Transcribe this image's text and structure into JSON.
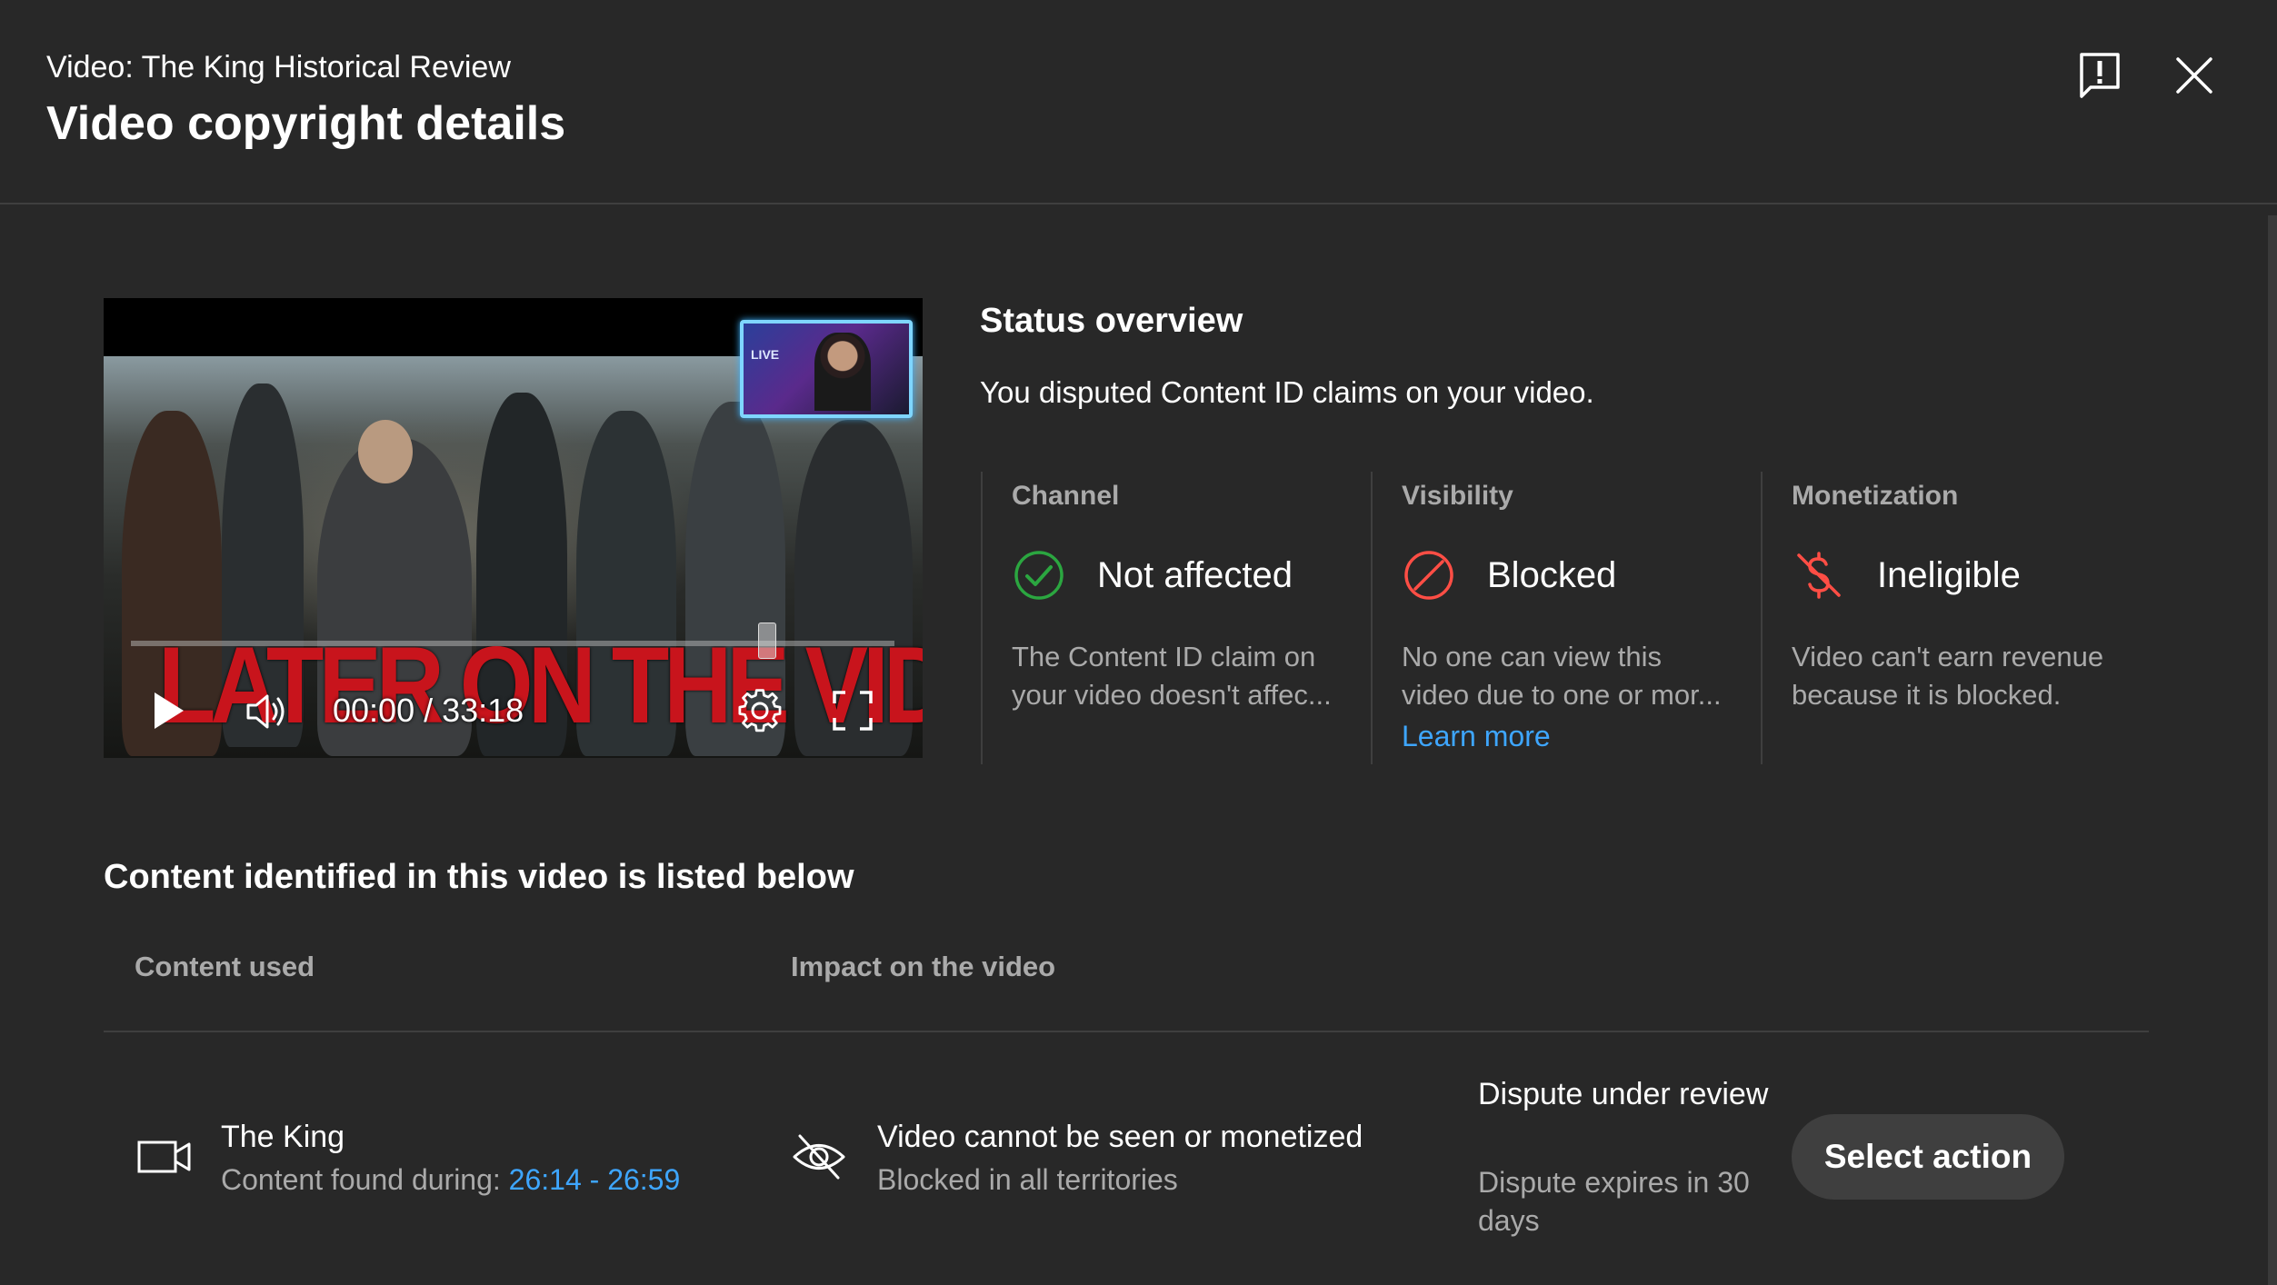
{
  "header": {
    "video_subtitle": "Video: The King Historical Review",
    "title": "Video copyright details",
    "feedback_icon": "feedback-icon",
    "close_icon": "close-icon"
  },
  "player": {
    "overlay_text": "LATER ON THE VIDEO",
    "pip_text": "LIVE",
    "time": "00:00 / 33:18",
    "progress_fraction": 0.0
  },
  "status": {
    "title": "Status overview",
    "description": "You disputed Content ID claims on your video.",
    "columns": [
      {
        "label": "Channel",
        "icon": "check-circle-icon",
        "value": "Not affected",
        "text_lines": [
          "The Content ID claim on",
          "your video doesn't affec..."
        ],
        "color": "#2ba640"
      },
      {
        "label": "Visibility",
        "icon": "blocked-icon",
        "value": "Blocked",
        "text_lines": [
          "No one can view this",
          "video due to one or mor..."
        ],
        "link": "Learn more",
        "color": "#ff4e45"
      },
      {
        "label": "Monetization",
        "icon": "no-money-icon",
        "value": "Ineligible",
        "text_lines": [
          "Video can't earn revenue",
          "because it is blocked."
        ],
        "color": "#ff4e45"
      }
    ]
  },
  "content": {
    "section_title": "Content identified in this video is listed below",
    "headers": {
      "content_used": "Content used",
      "impact": "Impact on the video"
    },
    "rows": [
      {
        "icon": "video-camera-icon",
        "title": "The King",
        "found_label": "Content found during: ",
        "found_range": "26:14 - 26:59",
        "impact_icon": "eye-off-icon",
        "impact_title": "Video cannot be seen or monetized",
        "impact_sub": "Blocked in all territories",
        "dispute_status": "Dispute under review",
        "dispute_expiry": "Dispute expires in 30 days",
        "action_label": "Select action"
      }
    ]
  },
  "colors": {
    "background": "#282828",
    "link": "#3ea6ff",
    "success": "#2ba640",
    "error": "#ff4e45"
  }
}
